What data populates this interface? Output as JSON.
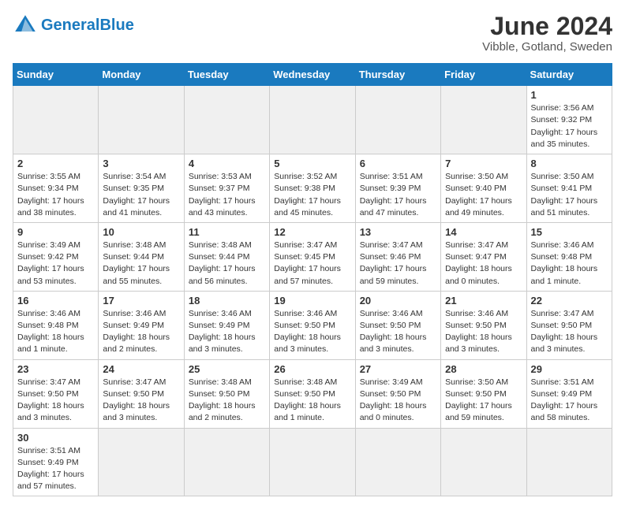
{
  "header": {
    "logo_general": "General",
    "logo_blue": "Blue",
    "month_title": "June 2024",
    "subtitle": "Vibble, Gotland, Sweden"
  },
  "days_of_week": [
    "Sunday",
    "Monday",
    "Tuesday",
    "Wednesday",
    "Thursday",
    "Friday",
    "Saturday"
  ],
  "weeks": [
    [
      {
        "day": "",
        "info": ""
      },
      {
        "day": "",
        "info": ""
      },
      {
        "day": "",
        "info": ""
      },
      {
        "day": "",
        "info": ""
      },
      {
        "day": "",
        "info": ""
      },
      {
        "day": "",
        "info": ""
      },
      {
        "day": "1",
        "info": "Sunrise: 3:56 AM\nSunset: 9:32 PM\nDaylight: 17 hours\nand 35 minutes."
      }
    ],
    [
      {
        "day": "2",
        "info": "Sunrise: 3:55 AM\nSunset: 9:34 PM\nDaylight: 17 hours\nand 38 minutes."
      },
      {
        "day": "3",
        "info": "Sunrise: 3:54 AM\nSunset: 9:35 PM\nDaylight: 17 hours\nand 41 minutes."
      },
      {
        "day": "4",
        "info": "Sunrise: 3:53 AM\nSunset: 9:37 PM\nDaylight: 17 hours\nand 43 minutes."
      },
      {
        "day": "5",
        "info": "Sunrise: 3:52 AM\nSunset: 9:38 PM\nDaylight: 17 hours\nand 45 minutes."
      },
      {
        "day": "6",
        "info": "Sunrise: 3:51 AM\nSunset: 9:39 PM\nDaylight: 17 hours\nand 47 minutes."
      },
      {
        "day": "7",
        "info": "Sunrise: 3:50 AM\nSunset: 9:40 PM\nDaylight: 17 hours\nand 49 minutes."
      },
      {
        "day": "8",
        "info": "Sunrise: 3:50 AM\nSunset: 9:41 PM\nDaylight: 17 hours\nand 51 minutes."
      }
    ],
    [
      {
        "day": "9",
        "info": "Sunrise: 3:49 AM\nSunset: 9:42 PM\nDaylight: 17 hours\nand 53 minutes."
      },
      {
        "day": "10",
        "info": "Sunrise: 3:48 AM\nSunset: 9:44 PM\nDaylight: 17 hours\nand 55 minutes."
      },
      {
        "day": "11",
        "info": "Sunrise: 3:48 AM\nSunset: 9:44 PM\nDaylight: 17 hours\nand 56 minutes."
      },
      {
        "day": "12",
        "info": "Sunrise: 3:47 AM\nSunset: 9:45 PM\nDaylight: 17 hours\nand 57 minutes."
      },
      {
        "day": "13",
        "info": "Sunrise: 3:47 AM\nSunset: 9:46 PM\nDaylight: 17 hours\nand 59 minutes."
      },
      {
        "day": "14",
        "info": "Sunrise: 3:47 AM\nSunset: 9:47 PM\nDaylight: 18 hours\nand 0 minutes."
      },
      {
        "day": "15",
        "info": "Sunrise: 3:46 AM\nSunset: 9:48 PM\nDaylight: 18 hours\nand 1 minute."
      }
    ],
    [
      {
        "day": "16",
        "info": "Sunrise: 3:46 AM\nSunset: 9:48 PM\nDaylight: 18 hours\nand 1 minute."
      },
      {
        "day": "17",
        "info": "Sunrise: 3:46 AM\nSunset: 9:49 PM\nDaylight: 18 hours\nand 2 minutes."
      },
      {
        "day": "18",
        "info": "Sunrise: 3:46 AM\nSunset: 9:49 PM\nDaylight: 18 hours\nand 3 minutes."
      },
      {
        "day": "19",
        "info": "Sunrise: 3:46 AM\nSunset: 9:50 PM\nDaylight: 18 hours\nand 3 minutes."
      },
      {
        "day": "20",
        "info": "Sunrise: 3:46 AM\nSunset: 9:50 PM\nDaylight: 18 hours\nand 3 minutes."
      },
      {
        "day": "21",
        "info": "Sunrise: 3:46 AM\nSunset: 9:50 PM\nDaylight: 18 hours\nand 3 minutes."
      },
      {
        "day": "22",
        "info": "Sunrise: 3:47 AM\nSunset: 9:50 PM\nDaylight: 18 hours\nand 3 minutes."
      }
    ],
    [
      {
        "day": "23",
        "info": "Sunrise: 3:47 AM\nSunset: 9:50 PM\nDaylight: 18 hours\nand 3 minutes."
      },
      {
        "day": "24",
        "info": "Sunrise: 3:47 AM\nSunset: 9:50 PM\nDaylight: 18 hours\nand 3 minutes."
      },
      {
        "day": "25",
        "info": "Sunrise: 3:48 AM\nSunset: 9:50 PM\nDaylight: 18 hours\nand 2 minutes."
      },
      {
        "day": "26",
        "info": "Sunrise: 3:48 AM\nSunset: 9:50 PM\nDaylight: 18 hours\nand 1 minute."
      },
      {
        "day": "27",
        "info": "Sunrise: 3:49 AM\nSunset: 9:50 PM\nDaylight: 18 hours\nand 0 minutes."
      },
      {
        "day": "28",
        "info": "Sunrise: 3:50 AM\nSunset: 9:50 PM\nDaylight: 17 hours\nand 59 minutes."
      },
      {
        "day": "29",
        "info": "Sunrise: 3:51 AM\nSunset: 9:49 PM\nDaylight: 17 hours\nand 58 minutes."
      }
    ],
    [
      {
        "day": "30",
        "info": "Sunrise: 3:51 AM\nSunset: 9:49 PM\nDaylight: 17 hours\nand 57 minutes."
      },
      {
        "day": "",
        "info": ""
      },
      {
        "day": "",
        "info": ""
      },
      {
        "day": "",
        "info": ""
      },
      {
        "day": "",
        "info": ""
      },
      {
        "day": "",
        "info": ""
      },
      {
        "day": "",
        "info": ""
      }
    ]
  ]
}
